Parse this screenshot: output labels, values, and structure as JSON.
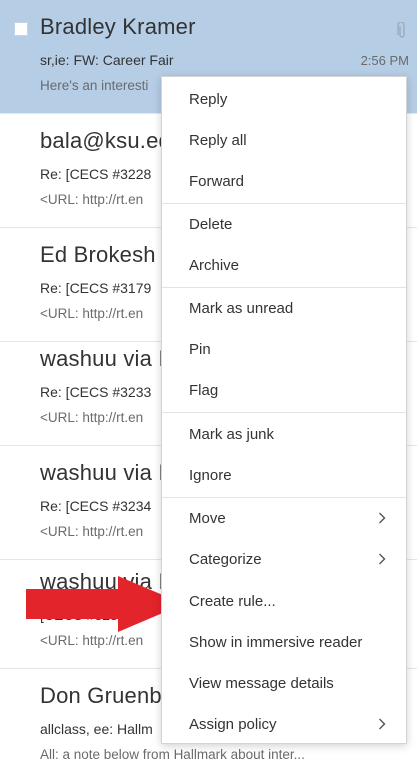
{
  "mail_list": [
    {
      "sender": "Bradley Kramer",
      "subject": "sr,ie: FW: Career Fair",
      "preview": "Here's an interesti",
      "time": "2:56 PM",
      "selected": true,
      "has_attachment": true
    },
    {
      "sender": "bala@ksu.ed",
      "subject": "Re: [CECS #3228",
      "preview": "<URL: http://rt.en",
      "time": "",
      "selected": false
    },
    {
      "sender": "Ed Brokesh v",
      "subject": "Re: [CECS #3179",
      "preview": "<URL: http://rt.en",
      "time": "",
      "selected": false
    },
    {
      "sender": "washuu via I",
      "subject": "Re: [CECS #3233",
      "preview": "<URL: http://rt.en",
      "time": "",
      "selected": false
    },
    {
      "sender": "washuu via I",
      "subject": "Re: [CECS #3234",
      "preview": "<URL: http://rt.en",
      "time": "",
      "selected": false
    },
    {
      "sender": "washuu via I",
      "subject": "[CECS #323",
      "preview": "<URL: http://rt.en",
      "time": "",
      "selected": false
    },
    {
      "sender": "Don Gruenb",
      "subject": "allclass, ee: Hallm",
      "preview": "All: a note below from Hallmark about inter...",
      "time": "",
      "selected": false
    }
  ],
  "context_menu": {
    "items": [
      {
        "label": "Reply",
        "submenu": false
      },
      {
        "label": "Reply all",
        "submenu": false
      },
      {
        "label": "Forward",
        "submenu": false
      },
      {
        "label": "Delete",
        "submenu": false
      },
      {
        "label": "Archive",
        "submenu": false
      },
      {
        "label": "Mark as unread",
        "submenu": false
      },
      {
        "label": "Pin",
        "submenu": false
      },
      {
        "label": "Flag",
        "submenu": false
      },
      {
        "label": "Mark as junk",
        "submenu": false
      },
      {
        "label": "Ignore",
        "submenu": false
      },
      {
        "label": "Move",
        "submenu": true
      },
      {
        "label": "Categorize",
        "submenu": true
      },
      {
        "label": "Create rule...",
        "submenu": false
      },
      {
        "label": "Show in immersive reader",
        "submenu": false
      },
      {
        "label": "View message details",
        "submenu": false
      },
      {
        "label": "Assign policy",
        "submenu": true
      }
    ]
  },
  "colors": {
    "selected_row": "#b6cde6",
    "annotation_arrow": "#e3242b"
  },
  "icons": {
    "attachment": "paperclip-icon",
    "submenu": "chevron-right-icon",
    "annotation": "red-arrow-icon"
  }
}
